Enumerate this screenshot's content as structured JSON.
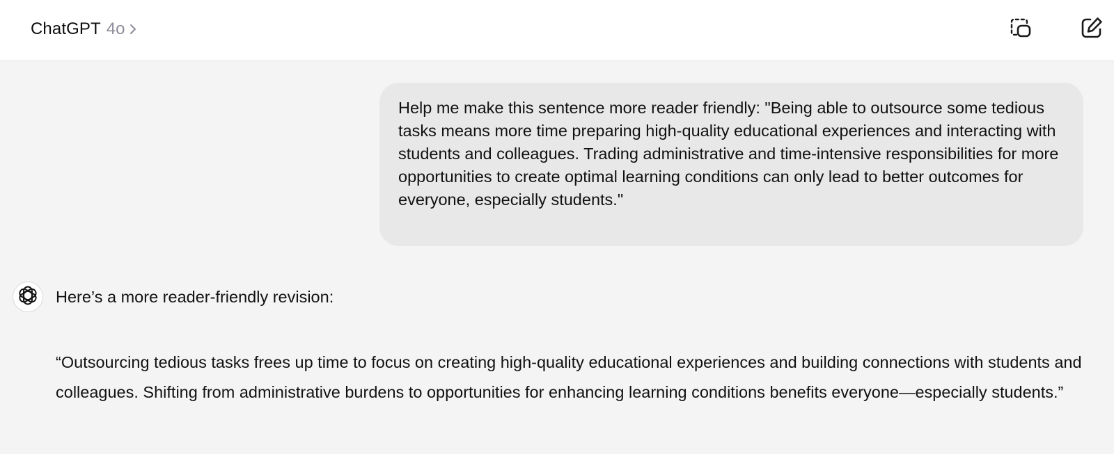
{
  "header": {
    "app_name": "ChatGPT",
    "model": "4o",
    "temporary_chat_icon": "temporary-chat-icon",
    "new_chat_icon": "new-chat-icon"
  },
  "conversation": {
    "user_message": "Help me make this sentence more reader friendly: \"Being able to outsource some tedious tasks means more time preparing high-quality educational experiences and interacting with students and colleagues. Trading administrative and time-intensive responsibilities for more opportunities to create optimal learning conditions can only lead to better outcomes for everyone, especially students.\"",
    "assistant_intro": "Here’s a more reader-friendly revision:",
    "assistant_revision": "“Outsourcing tedious tasks frees up time to focus on creating high-quality educational experiences and building connections with students and colleagues. Shifting from administrative burdens to opportunities for enhancing learning conditions benefits everyone—especially students.”"
  },
  "colors": {
    "header_bg": "#ffffff",
    "page_bg": "#f4f4f4",
    "user_bubble_bg": "#e8e8e8",
    "model_text": "#8c8c99"
  }
}
